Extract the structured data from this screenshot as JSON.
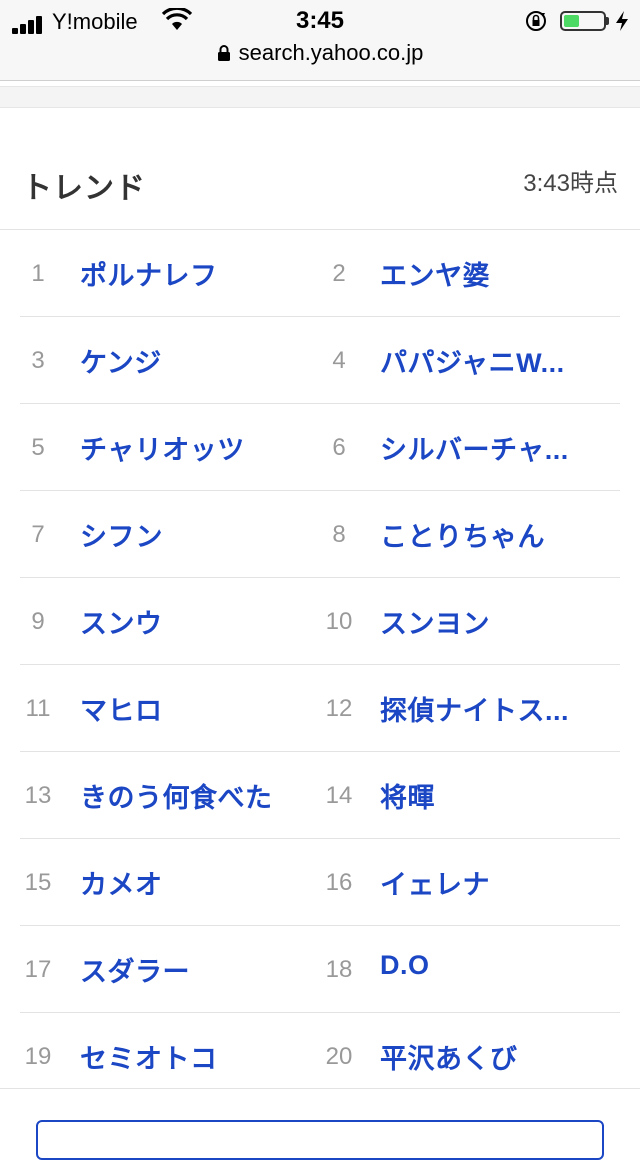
{
  "status_bar": {
    "carrier": "Y!mobile",
    "time": "3:45",
    "battery_level": 0.4,
    "battery_color": "#4cd964"
  },
  "url_bar": {
    "url": "search.yahoo.co.jp"
  },
  "trend": {
    "title": "トレンド",
    "updated": "3:43時点",
    "rows": [
      [
        {
          "rank": "1",
          "term": "ポルナレフ"
        },
        {
          "rank": "2",
          "term": "エンヤ婆"
        }
      ],
      [
        {
          "rank": "3",
          "term": "ケンジ"
        },
        {
          "rank": "4",
          "term": "パパジャニW..."
        }
      ],
      [
        {
          "rank": "5",
          "term": "チャリオッツ"
        },
        {
          "rank": "6",
          "term": "シルバーチャ..."
        }
      ],
      [
        {
          "rank": "7",
          "term": "シフン"
        },
        {
          "rank": "8",
          "term": "ことりちゃん"
        }
      ],
      [
        {
          "rank": "9",
          "term": "スンウ"
        },
        {
          "rank": "10",
          "term": "スンヨン"
        }
      ],
      [
        {
          "rank": "11",
          "term": "マヒロ"
        },
        {
          "rank": "12",
          "term": "探偵ナイトス..."
        }
      ],
      [
        {
          "rank": "13",
          "term": "きのう何食べた"
        },
        {
          "rank": "14",
          "term": "将暉"
        }
      ],
      [
        {
          "rank": "15",
          "term": "カメオ"
        },
        {
          "rank": "16",
          "term": "イェレナ"
        }
      ],
      [
        {
          "rank": "17",
          "term": "スダラー"
        },
        {
          "rank": "18",
          "term": "D.O"
        }
      ],
      [
        {
          "rank": "19",
          "term": "セミオトコ"
        },
        {
          "rank": "20",
          "term": "平沢あくび"
        }
      ]
    ]
  },
  "colors": {
    "link": "#1b46c4",
    "rank": "#999999"
  },
  "icons": [
    "signal-icon",
    "wifi-icon",
    "rotation-lock-icon",
    "battery-icon",
    "charging-bolt-icon",
    "lock-icon"
  ]
}
